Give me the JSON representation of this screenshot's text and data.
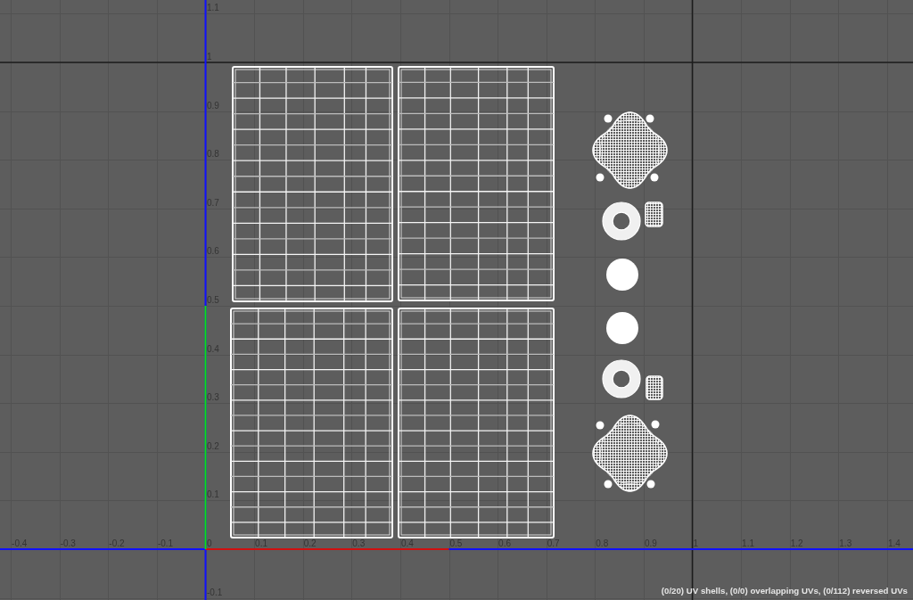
{
  "canvas": {
    "origin_label": "0",
    "u_labels": [
      "-0.4",
      "-0.3",
      "-0.2",
      "-0.1",
      "0.1",
      "0.2",
      "0.3",
      "0.4",
      "0.5",
      "0.6",
      "0.7",
      "0.8",
      "0.9",
      "1",
      "1.1",
      "1.2",
      "1.3",
      "1.4"
    ],
    "v_labels": [
      "1.1",
      "1",
      "0.9",
      "0.8",
      "0.7",
      "0.6",
      "0.5",
      "0.4",
      "0.3",
      "0.2",
      "0.1",
      "-0.1"
    ],
    "uv_shells": [
      {
        "kind": "grid"
      },
      {
        "kind": "grid"
      },
      {
        "kind": "grid"
      },
      {
        "kind": "grid"
      },
      {
        "kind": "mesh"
      },
      {
        "kind": "dot"
      },
      {
        "kind": "dot"
      },
      {
        "kind": "dot"
      },
      {
        "kind": "dot"
      },
      {
        "kind": "ring"
      },
      {
        "kind": "cylinder"
      },
      {
        "kind": "disc"
      },
      {
        "kind": "disc"
      },
      {
        "kind": "ring"
      },
      {
        "kind": "cylinder"
      },
      {
        "kind": "mesh"
      },
      {
        "kind": "dot"
      },
      {
        "kind": "dot"
      },
      {
        "kind": "dot"
      },
      {
        "kind": "dot"
      }
    ]
  },
  "status_bar": {
    "text": "(0/20) UV shells, (0/0) overlapping UVs, (0/112) reversed UVs"
  }
}
